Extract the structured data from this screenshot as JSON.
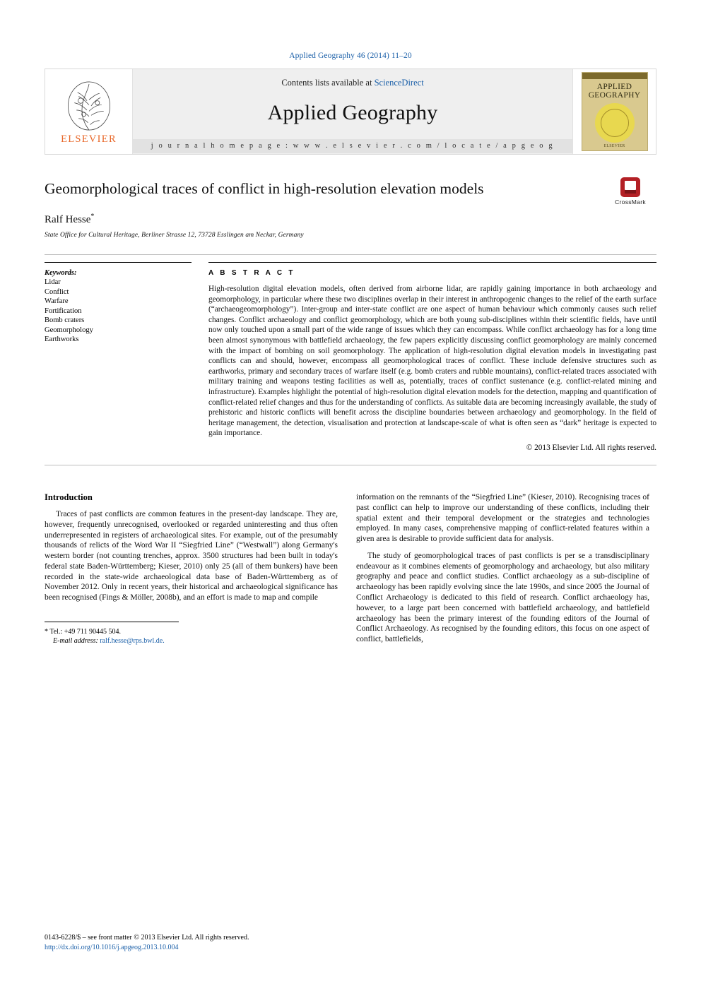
{
  "journal_ref": "Applied Geography 46 (2014) 11–20",
  "masthead": {
    "publisher": "ELSEVIER",
    "contents_prefix": "Contents lists available at ",
    "contents_link": "ScienceDirect",
    "journal_name": "Applied Geography",
    "homepage": "j o u r n a l   h o m e p a g e :   w w w . e l s e v i e r . c o m / l o c a t e / a p g e o g",
    "cover": {
      "line1": "APPLIED",
      "line2": "GEOGRAPHY",
      "footer_text": "ELSEVIER"
    }
  },
  "article": {
    "title": "Geomorphological traces of conflict in high-resolution elevation models",
    "author": "Ralf Hesse",
    "author_marker": "*",
    "affiliation": "State Office for Cultural Heritage, Berliner Strasse 12, 73728 Esslingen am Neckar, Germany",
    "crossmark_label": "CrossMark"
  },
  "keywords": {
    "heading": "Keywords:",
    "items": [
      "Lidar",
      "Conflict",
      "Warfare",
      "Fortification",
      "Bomb craters",
      "Geomorphology",
      "Earthworks"
    ]
  },
  "abstract": {
    "heading": "A B S T R A C T",
    "text": "High-resolution digital elevation models, often derived from airborne lidar, are rapidly gaining importance in both archaeology and geomorphology, in particular where these two disciplines overlap in their interest in anthropogenic changes to the relief of the earth surface (“archaeogeomorphology”). Inter-group and inter-state conflict are one aspect of human behaviour which commonly causes such relief changes. Conflict archaeology and conflict geomorphology, which are both young sub-disciplines within their scientific fields, have until now only touched upon a small part of the wide range of issues which they can encompass. While conflict archaeology has for a long time been almost synonymous with battlefield archaeology, the few papers explicitly discussing conflict geomorphology are mainly concerned with the impact of bombing on soil geomorphology. The application of high-resolution digital elevation models in investigating past conflicts can and should, however, encompass all geomorphological traces of conflict. These include defensive structures such as earthworks, primary and secondary traces of warfare itself (e.g. bomb craters and rubble mountains), conflict-related traces associated with military training and weapons testing facilities as well as, potentially, traces of conflict sustenance (e.g. conflict-related mining and infrastructure). Examples highlight the potential of high-resolution digital elevation models for the detection, mapping and quantification of conflict-related relief changes and thus for the understanding of conflicts. As suitable data are becoming increasingly available, the study of prehistoric and historic conflicts will benefit across the discipline boundaries between archaeology and geomorphology. In the field of heritage management, the detection, visualisation and protection at landscape-scale of what is often seen as “dark” heritage is expected to gain importance.",
    "copyright": "© 2013 Elsevier Ltd. All rights reserved."
  },
  "body": {
    "section_title": "Introduction",
    "left_paragraphs": [
      "Traces of past conflicts are common features in the present-day landscape. They are, however, frequently unrecognised, overlooked or regarded uninteresting and thus often underrepresented in registers of archaeological sites. For example, out of the presumably thousands of relicts of the Word War II “Siegfried Line” (“Westwall”) along Germany's western border (not counting trenches, approx. 3500 structures had been built in today's federal state Baden-Württemberg; Kieser, 2010) only 25 (all of them bunkers) have been recorded in the state-wide archaeological data base of Baden-Württemberg as of November 2012. Only in recent years, their historical and archaeological significance has been recognised (Fings & Möller, 2008b), and an effort is made to map and compile"
    ],
    "right_paragraphs": [
      "information on the remnants of the “Siegfried Line” (Kieser, 2010). Recognising traces of past conflict can help to improve our understanding of these conflicts, including their spatial extent and their temporal development or the strategies and technologies employed. In many cases, comprehensive mapping of conflict-related features within a given area is desirable to provide sufficient data for analysis.",
      "The study of geomorphological traces of past conflicts is per se a transdisciplinary endeavour as it combines elements of geomorphology and archaeology, but also military geography and peace and conflict studies. Conflict archaeology as a sub-discipline of archaeology has been rapidly evolving since the late 1990s, and since 2005 the Journal of Conflict Archaeology is dedicated to this field of research. Conflict archaeology has, however, to a large part been concerned with battlefield archaeology, and battlefield archaeology has been the primary interest of the founding editors of the Journal of Conflict Archaeology. As recognised by the founding editors, this focus on one aspect of conflict, battlefields,"
    ]
  },
  "footnote": {
    "tel": "* Tel.: +49 711 90445 504.",
    "email_label": "E-mail address:",
    "email": "ralf.hesse@rps.bwl.de."
  },
  "footer": {
    "issn_line": "0143-6228/$ – see front matter © 2013 Elsevier Ltd. All rights reserved.",
    "doi": "http://dx.doi.org/10.1016/j.apgeog.2013.10.004"
  },
  "colors": {
    "link": "#1a5fa8",
    "elsevier_orange": "#e8682a",
    "crossmark_red": "#b32025"
  }
}
